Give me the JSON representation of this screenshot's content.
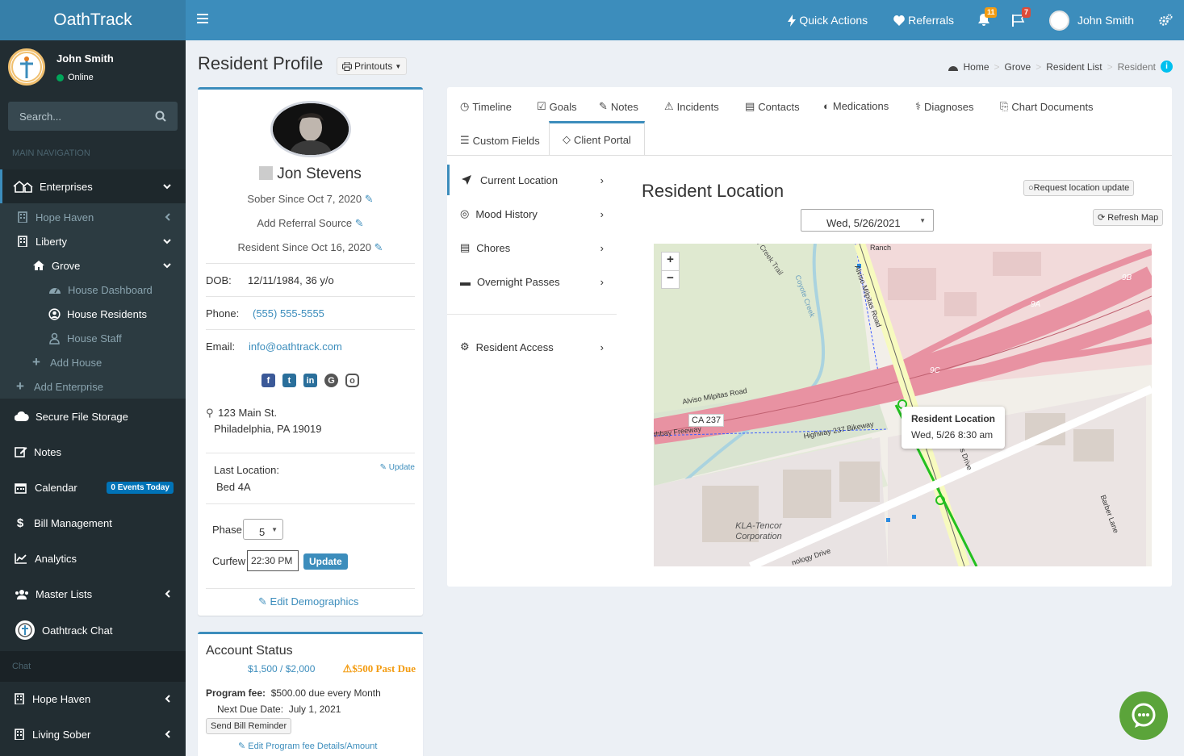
{
  "brand": {
    "name": "OathTrack"
  },
  "topbar": {
    "quick_actions": "Quick Actions",
    "referrals": "Referrals",
    "notifications_count": "11",
    "flags_count": "7",
    "user_name": "John Smith"
  },
  "sidebar": {
    "user_name": "John Smith",
    "status": "Online",
    "search_placeholder": "Search...",
    "main_nav_header": "MAIN NAVIGATION",
    "enterprises": "Enterprises",
    "hope_haven": "Hope Haven",
    "liberty": "Liberty",
    "grove": "Grove",
    "house_dashboard": "House Dashboard",
    "house_residents": "House Residents",
    "house_staff": "House Staff",
    "add_house": "Add House",
    "add_enterprise": "Add Enterprise",
    "secure_file_storage": "Secure File Storage",
    "notes": "Notes",
    "calendar": "Calendar",
    "calendar_badge": "0 Events Today",
    "bill_management": "Bill Management",
    "analytics": "Analytics",
    "master_lists": "Master Lists",
    "chat_item": "Oathtrack Chat",
    "chat_header": "Chat",
    "chat_hope_haven": "Hope Haven",
    "chat_living_sober": "Living Sober"
  },
  "page": {
    "title": "Resident Profile",
    "printouts": "Printouts",
    "breadcrumb": [
      "Home",
      "Grove",
      "Resident List",
      "Resident"
    ]
  },
  "profile": {
    "name": "Jon Stevens",
    "sober_since": "Sober Since Oct 7, 2020",
    "referral": "Add Referral Source",
    "resident_since": "Resident Since Oct 16, 2020",
    "dob_label": "DOB:",
    "dob": "12/11/1984, 36 y/o",
    "phone_label": "Phone:",
    "phone": "(555) 555-5555",
    "email_label": "Email:",
    "email": "info@oathtrack.com",
    "address_line1": "123 Main St.",
    "address_line2": "Philadelphia, PA 19019",
    "last_location_label": "Last Location:",
    "last_location": "Bed 4A",
    "update_link": "Update",
    "phase_label": "Phase",
    "phase": "5",
    "curfew_label": "Curfew",
    "curfew": "22:30 PM",
    "update_button": "Update",
    "edit_demographics": "Edit Demographics"
  },
  "account": {
    "title": "Account Status",
    "balance": "$1,500 / $2,000",
    "past_due": "$500 Past Due",
    "program_fee_label": "Program fee:",
    "program_fee": "$500.00 due every Month",
    "next_due_label": "Next Due Date:",
    "next_due": "July 1, 2021",
    "reminder_button": "Send Bill Reminder",
    "edit_fee_link": "Edit Program fee Details/Amount"
  },
  "tabs": [
    "Timeline",
    "Goals",
    "Notes",
    "Incidents",
    "Contacts",
    "Medications",
    "Diagnoses",
    "Chart Documents",
    "Custom Fields",
    "Client Portal"
  ],
  "portal_nav": [
    "Current Location",
    "Mood History",
    "Chores",
    "Overnight Passes",
    "Resident Access"
  ],
  "location": {
    "title": "Resident Location",
    "request_button": "Request location update",
    "date": "Wed, 5/26/2021",
    "refresh_button": "Refresh Map",
    "marker_title": "Resident Location",
    "marker_time": "Wed, 5/26 8:30 am"
  },
  "map_labels": {
    "road1": "Alviso Milpitas Road",
    "road2": "Alviso Milpitas Road",
    "ca237": "CA 237",
    "freeway": "thbay Freeway",
    "bikeway": "Highway 237 Bikeway",
    "creek": "Coyote Creek",
    "trail": "e Creek Trail",
    "company": "KLA-Tencor Corporation",
    "barber": "Barber Lane",
    "drive": "ss Drive",
    "tech": "nology Drive",
    "ramp_9a": "9A",
    "ramp_9b": "9B",
    "ramp_9c": "9C",
    "ranch": "Ranch"
  },
  "colors": {
    "primary": "#3c8dbc",
    "sidebar": "#222d32",
    "warning": "#f39c12",
    "chat": "#5ba43a"
  }
}
